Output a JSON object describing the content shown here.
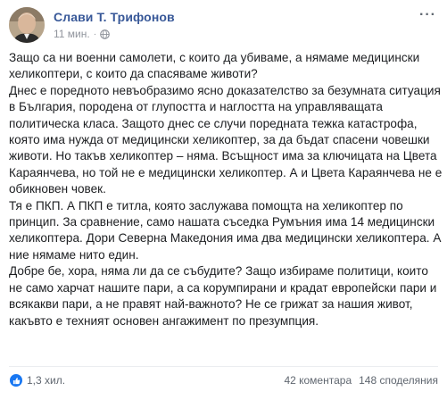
{
  "post": {
    "author": "Слави Т. Трифонов",
    "time": "11 мин.",
    "separator": "·",
    "more_label": "···",
    "paragraphs": [
      "Защо са ни военни самолети, с които да убиваме, а нямаме медицински хеликоптери, с които да спасяваме животи?",
      "Днес е поредното невъобразимо ясно доказателство за безумната ситуация в България, породена от глупостта и наглостта на управляващата политическа класа. Защото днес се случи поредната тежка катастрофа, която има нужда от медицински хеликоптер, за да бъдат спасени човешки животи. Но такъв хеликоптер – няма. Всъщност има за ключицата на Цвета Караянчева, но той не е медицински хеликоптер. А и Цвета Караянчева не е обикновен човек.",
      "Тя е ПКП. А ПКП е титла, която заслужава помощта на хеликоптер по принцип. За сравнение, само нашата съседка Румъния има 14 медицински хеликоптера. Дори Северна Македония има два медицински хеликоптера. А ние нямаме нито един.",
      "Добре бе, хора, няма ли да се събудите? Защо избираме политици, които не само харчат нашите пари, а са корумпирани и крадат европейски пари и всякакви пари, а не правят най-важното? Не се грижат за нашия живот, какъвто е техният основен ангажимент по презумпция."
    ],
    "reactions_count": "1,3 хил.",
    "comments": "42 коментара",
    "shares": "148 споделяния",
    "colors": {
      "author": "#385898",
      "like": "#1877f2",
      "meta": "#90949c"
    },
    "icons": {
      "privacy": "globe-icon",
      "reaction": "like-icon",
      "menu": "more-icon"
    }
  }
}
